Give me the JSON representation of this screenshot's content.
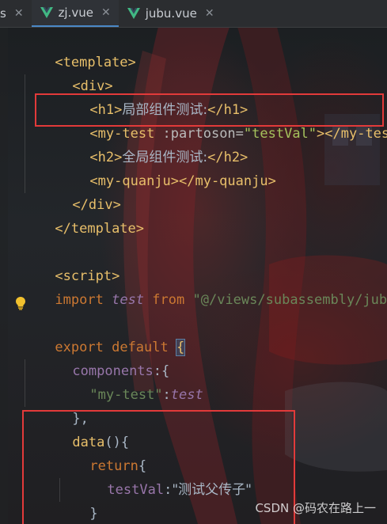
{
  "tabs": [
    {
      "label": "s",
      "active": false,
      "partial": true
    },
    {
      "label": "zj.vue",
      "active": true
    },
    {
      "label": "jubu.vue",
      "active": false
    }
  ],
  "code": {
    "l1": {
      "open": "<template>"
    },
    "l2": {
      "open": "<div>"
    },
    "l3": {
      "tag_open": "<h1>",
      "text": "局部组件测试:",
      "tag_close": "</h1>"
    },
    "l4": {
      "tag_open": "<my-test",
      "attr": " :partoson=",
      "val": "\"testVal\"",
      "tag_end": "></my-test>"
    },
    "l5": {
      "tag_open": "<h2>",
      "text": "全局组件测试:",
      "tag_close": "</h2>"
    },
    "l6": {
      "tag": "<my-quanju></my-quanju>"
    },
    "l7": {
      "tag": "</div>"
    },
    "l8": {
      "tag": "</template>"
    },
    "l10": {
      "tag": "<script>"
    },
    "l11": {
      "kw1": "import",
      "name": "test",
      "kw2": "from",
      "path": "\"@/views/subassembly/jubu.v"
    },
    "l13": {
      "kw1": "export",
      "kw2": "default",
      "brace": "{"
    },
    "l14": {
      "prop": "components",
      "rest": ":{"
    },
    "l15": {
      "key": "\"my-test\"",
      "colon": ":",
      "val": "test"
    },
    "l16": {
      "text": "},"
    },
    "l17": {
      "fn": "data",
      "rest": "(){"
    },
    "l18": {
      "kw": "return",
      "rest": "{"
    },
    "l19": {
      "key": "testVal",
      "colon": ":",
      "val": "\"测试父传子\""
    },
    "l20": {
      "text": "}"
    }
  },
  "watermark": "CSDN @码农在路上一",
  "colors": {
    "highlight_box": "#e23a3a",
    "tag": "#e8bf6a",
    "keyword": "#cc7832",
    "string": "#6a8759"
  },
  "icons": [
    "vue-icon",
    "close-icon",
    "lightbulb-icon"
  ]
}
